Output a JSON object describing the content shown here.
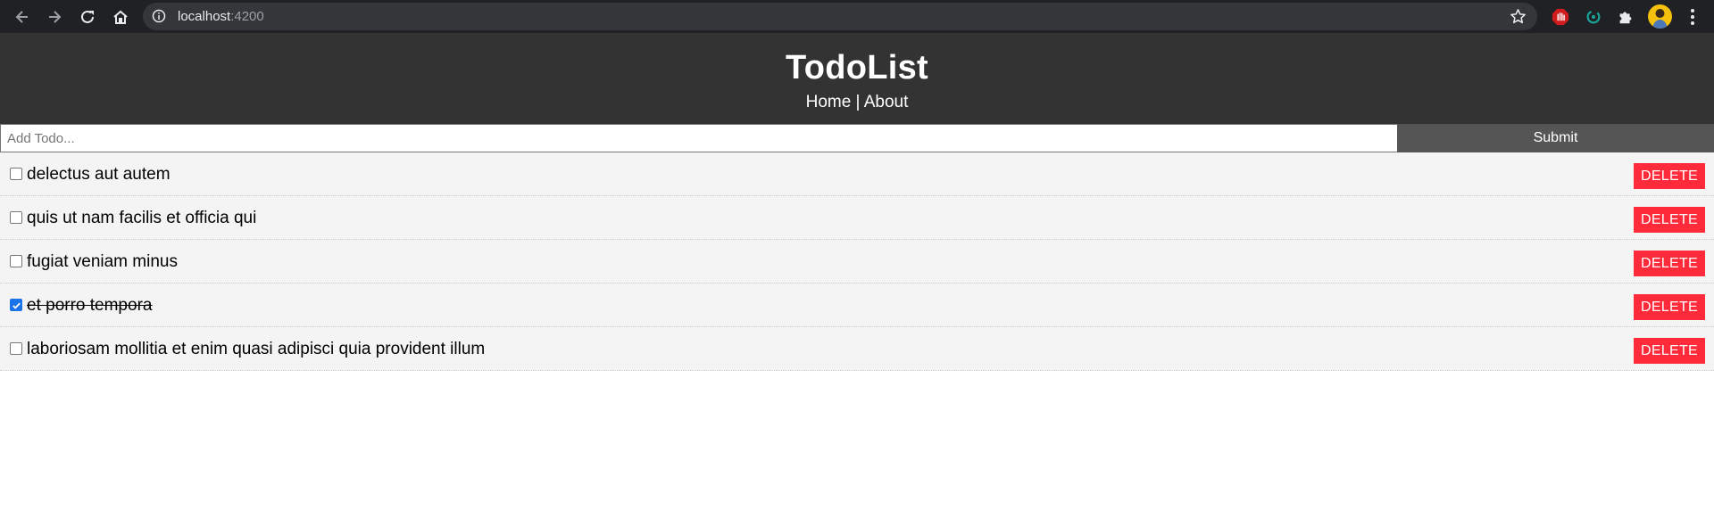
{
  "browser": {
    "url_host": "localhost",
    "url_port": ":4200",
    "icons": [
      "back-icon",
      "forward-icon",
      "reload-icon",
      "home-icon",
      "info-icon",
      "star-icon",
      "extension-stop-icon",
      "extension-sync-icon",
      "extensions-puzzle-icon",
      "profile-avatar",
      "menu-kebab-icon"
    ]
  },
  "header": {
    "title": "TodoList",
    "nav_home": "Home",
    "nav_separator": " | ",
    "nav_about": "About"
  },
  "add_form": {
    "placeholder": "Add Todo...",
    "submit_label": "Submit"
  },
  "todos": [
    {
      "title": "delectus aut autem",
      "completed": false
    },
    {
      "title": "quis ut nam facilis et officia qui",
      "completed": false
    },
    {
      "title": "fugiat veniam minus",
      "completed": false
    },
    {
      "title": "et porro tempora",
      "completed": true
    },
    {
      "title": "laboriosam mollitia et enim quasi adipisci quia provident illum",
      "completed": false
    }
  ],
  "delete_label": "DELETE",
  "colors": {
    "header_bg": "#333333",
    "submit_bg": "#555555",
    "delete_bg": "#ff2a3a",
    "item_bg": "#f4f4f4",
    "checkbox_checked": "#1a73e8"
  }
}
